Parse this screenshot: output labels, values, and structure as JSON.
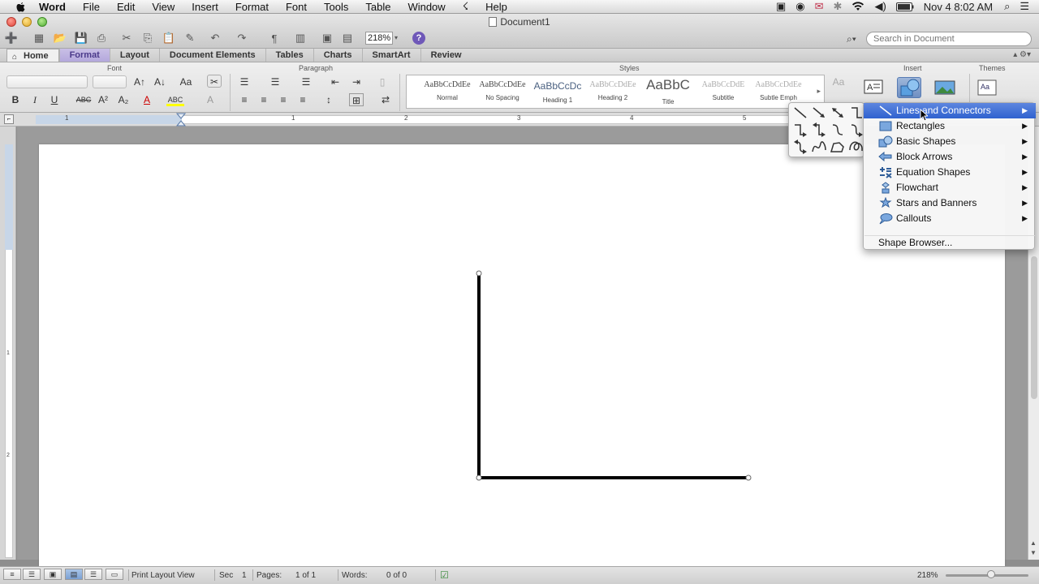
{
  "menubar": {
    "app": "Word",
    "items": [
      "File",
      "Edit",
      "View",
      "Insert",
      "Format",
      "Font",
      "Tools",
      "Table",
      "Window",
      "Help"
    ],
    "clock": "Nov 4  8:02 AM"
  },
  "window": {
    "title": "Document1",
    "zoom": "218%",
    "search_placeholder": "Search in Document"
  },
  "ribbon": {
    "tabs": [
      "Home",
      "Format",
      "Layout",
      "Document Elements",
      "Tables",
      "Charts",
      "SmartArt",
      "Review"
    ],
    "active_tab": "Home",
    "groups": {
      "font": "Font",
      "paragraph": "Paragraph",
      "styles": "Styles",
      "insert": "Insert",
      "themes": "Themes"
    },
    "styles": [
      {
        "preview": "AaBbCcDdEe",
        "name": "Normal"
      },
      {
        "preview": "AaBbCcDdEe",
        "name": "No Spacing"
      },
      {
        "preview": "AaBbCcDc",
        "name": "Heading 1"
      },
      {
        "preview": "AaBbCcDdEe",
        "name": "Heading 2"
      },
      {
        "preview": "AaBbC",
        "name": "Title"
      },
      {
        "preview": "AaBbCcDdE",
        "name": "Subtitle"
      },
      {
        "preview": "AaBbCcDdEe",
        "name": "Subtle Emph"
      }
    ]
  },
  "ruler": {
    "numbers": [
      "1",
      "1",
      "2",
      "3",
      "4",
      "5"
    ],
    "vnumbers": [
      "1",
      "2"
    ]
  },
  "shapes_menu": {
    "items": [
      {
        "label": "Lines and Connectors",
        "icon": "line-connector-icon",
        "highlighted": true
      },
      {
        "label": "Rectangles",
        "icon": "rectangle-icon"
      },
      {
        "label": "Basic Shapes",
        "icon": "basic-shapes-icon"
      },
      {
        "label": "Block Arrows",
        "icon": "block-arrows-icon"
      },
      {
        "label": "Equation Shapes",
        "icon": "equation-shapes-icon"
      },
      {
        "label": "Flowchart",
        "icon": "flowchart-icon"
      },
      {
        "label": "Stars and Banners",
        "icon": "stars-banners-icon"
      },
      {
        "label": "Callouts",
        "icon": "callouts-icon"
      }
    ],
    "browser": "Shape Browser..."
  },
  "statusbar": {
    "view": "Print Layout View",
    "sec_label": "Sec",
    "sec_value": "1",
    "pages_label": "Pages:",
    "pages_value": "1 of 1",
    "words_label": "Words:",
    "words_value": "0 of 0",
    "zoom": "218%"
  },
  "colors": {
    "menu_highlight": "#3a6bd4",
    "format_tab": "#b4a8dc",
    "help": "#6f58b8"
  }
}
